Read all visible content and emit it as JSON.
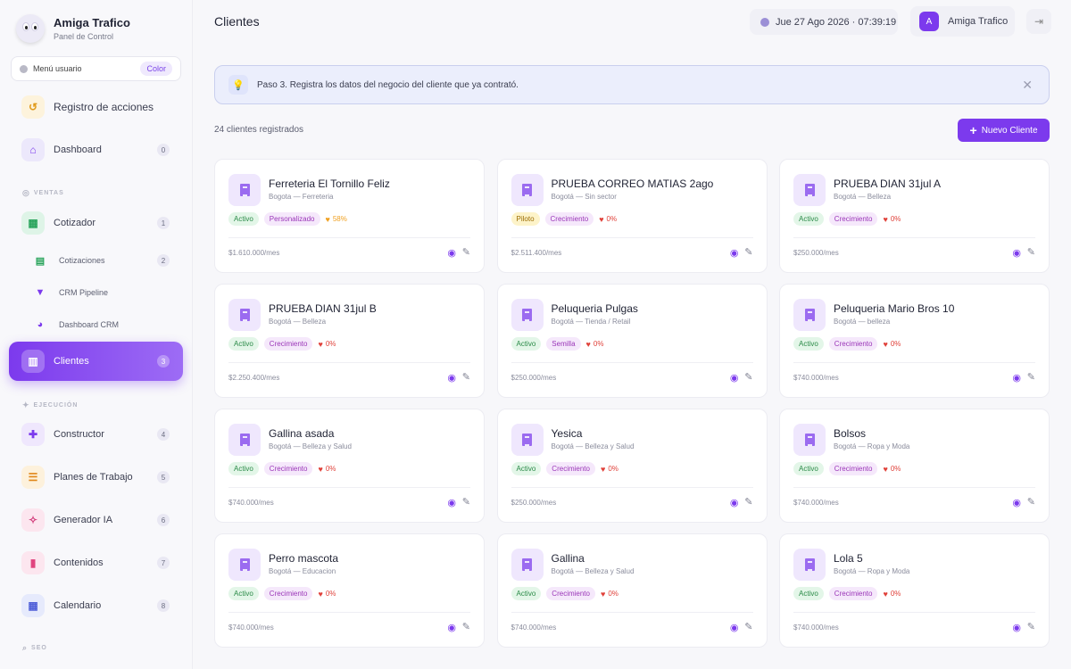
{
  "brand": {
    "name": "Amiga Trafico",
    "subtitle": "Panel de Control"
  },
  "menu_user": {
    "label": "Menú usuario",
    "badge": "Color"
  },
  "sidebar": {
    "registro": "Registro de acciones",
    "items": [
      {
        "label": "Dashboard",
        "count": "0"
      },
      {
        "label": "Cotizador",
        "count": "1"
      },
      {
        "label": "Cotizaciones",
        "count": "2"
      },
      {
        "label": "CRM Pipeline"
      },
      {
        "label": "Dashboard CRM"
      },
      {
        "label": "Clientes",
        "count": "3"
      },
      {
        "label": "Constructor",
        "count": "4"
      },
      {
        "label": "Planes de Trabajo",
        "count": "5"
      },
      {
        "label": "Generador IA",
        "count": "6"
      },
      {
        "label": "Contenidos",
        "count": "7"
      },
      {
        "label": "Calendario",
        "count": "8"
      }
    ],
    "sections": {
      "ventas": "VENTAS",
      "ejecucion": "EJECUCIÓN",
      "seo": "SEO"
    }
  },
  "topbar": {
    "title": "Clientes",
    "datetime": "Jue 27 Ago 2026 · 07:39:19",
    "user": "Amiga Trafico",
    "avatar": "A"
  },
  "info": {
    "text": "Paso 3. Registra los datos del negocio del cliente que ya contrató."
  },
  "summary": {
    "count_text": "24 clientes registrados",
    "new_button": "Nuevo Cliente"
  },
  "clients": [
    {
      "name": "Ferreteria El Tornillo Feliz",
      "meta": "Bogota — Ferreteria",
      "status": "Activo",
      "plan": "Personalizado",
      "pct": "58%",
      "price": "$1.610.000/mes"
    },
    {
      "name": "PRUEBA CORREO MATIAS 2ago",
      "meta": "Bogotá — Sin sector",
      "status": "Piloto",
      "plan": "Crecimiento",
      "pct": "0%",
      "price": "$2.511.400/mes"
    },
    {
      "name": "PRUEBA DIAN 31jul A",
      "meta": "Bogotá — Belleza",
      "status": "Activo",
      "plan": "Crecimiento",
      "pct": "0%",
      "price": "$250.000/mes"
    },
    {
      "name": "PRUEBA DIAN 31jul B",
      "meta": "Bogotá — Belleza",
      "status": "Activo",
      "plan": "Crecimiento",
      "pct": "0%",
      "price": "$2.250.400/mes"
    },
    {
      "name": "Peluqueria Pulgas",
      "meta": "Bogotá — Tienda / Retail",
      "status": "Activo",
      "plan": "Semilla",
      "pct": "0%",
      "price": "$250.000/mes"
    },
    {
      "name": "Peluqueria Mario Bros 10",
      "meta": "Bogotá — belleza",
      "status": "Activo",
      "plan": "Crecimiento",
      "pct": "0%",
      "price": "$740.000/mes"
    },
    {
      "name": "Gallina asada",
      "meta": "Bogotá — Belleza y Salud",
      "status": "Activo",
      "plan": "Crecimiento",
      "pct": "0%",
      "price": "$740.000/mes"
    },
    {
      "name": "Yesica",
      "meta": "Bogotá — Belleza y Salud",
      "status": "Activo",
      "plan": "Crecimiento",
      "pct": "0%",
      "price": "$250.000/mes"
    },
    {
      "name": "Bolsos",
      "meta": "Bogotá — Ropa y Moda",
      "status": "Activo",
      "plan": "Crecimiento",
      "pct": "0%",
      "price": "$740.000/mes"
    },
    {
      "name": "Perro mascota",
      "meta": "Bogotá — Educacion",
      "status": "Activo",
      "plan": "Crecimiento",
      "pct": "0%",
      "price": "$740.000/mes"
    },
    {
      "name": "Gallina",
      "meta": "Bogotá — Belleza y Salud",
      "status": "Activo",
      "plan": "Crecimiento",
      "pct": "0%",
      "price": "$740.000/mes"
    },
    {
      "name": "Lola 5",
      "meta": "Bogotá — Ropa y Moda",
      "status": "Activo",
      "plan": "Crecimiento",
      "pct": "0%",
      "price": "$740.000/mes"
    }
  ],
  "colors": {
    "accent": "#7c3aed",
    "active_tag": "#2a8a47",
    "pilot_tag": "#9a6b00",
    "plan_tag": "#9a35b8",
    "heart": "#e0413a",
    "heart_warm": "#f0a020"
  }
}
